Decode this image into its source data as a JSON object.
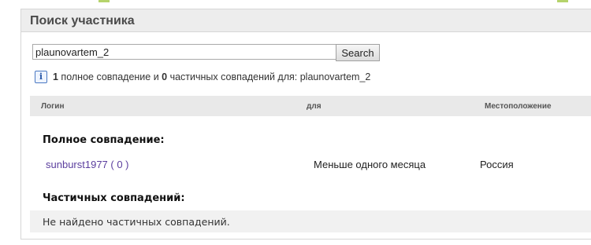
{
  "colors": {
    "panel_header_bg": "#ededed",
    "link": "#5b3e9e",
    "accent": "#b5d36b",
    "info_icon": "#2c5aa8"
  },
  "panel": {
    "title": "Поиск участника"
  },
  "search": {
    "value": "plaunovartem_2",
    "button_label": "Search"
  },
  "info": {
    "icon": "info-icon",
    "full_count": "1",
    "text_mid": " полное совпадение и ",
    "partial_count": "0",
    "text_end": " частичных совпадений для: plaunovartem_2"
  },
  "table": {
    "columns": {
      "login": "Логин",
      "for": "для",
      "location": "Местоположение"
    },
    "full_match_title": "Полное совпадение:",
    "full_matches": [
      {
        "login": "sunburst1977",
        "count": " ( 0 )",
        "for": "Меньше одного месяца",
        "location": "Россия"
      }
    ],
    "partial_match_title": "Частичных совпадений:",
    "no_partial_text": "Не найдено частичных совпадений."
  }
}
